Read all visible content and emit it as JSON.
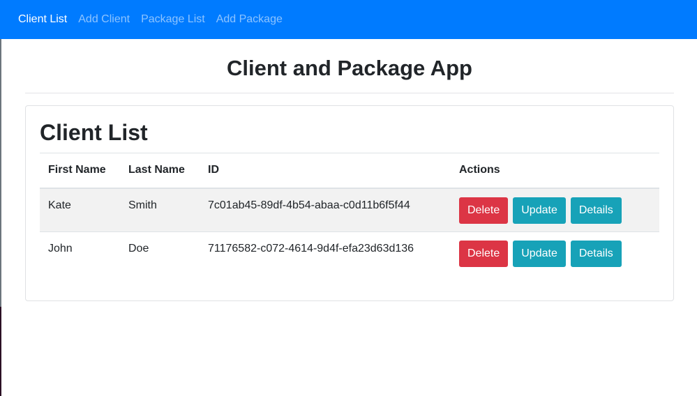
{
  "navbar": {
    "links": [
      "Client List",
      "Add Client",
      "Package List",
      "Add Package"
    ],
    "active_index": 0
  },
  "app_title": "Client and Package App",
  "card": {
    "title": "Client List",
    "columns": [
      "First Name",
      "Last Name",
      "ID",
      "Actions"
    ],
    "rows": [
      {
        "first": "Kate",
        "last": "Smith",
        "id": "7c01ab45-89df-4b54-abaa-c0d11b6f5f44"
      },
      {
        "first": "John",
        "last": "Doe",
        "id": "71176582-c072-4614-9d4f-efa23d63d136"
      }
    ],
    "actions": {
      "delete": "Delete",
      "update": "Update",
      "details": "Details"
    }
  },
  "colors": {
    "navbar": "#007bff",
    "delete": "#dc3545",
    "info": "#17a2b8"
  }
}
